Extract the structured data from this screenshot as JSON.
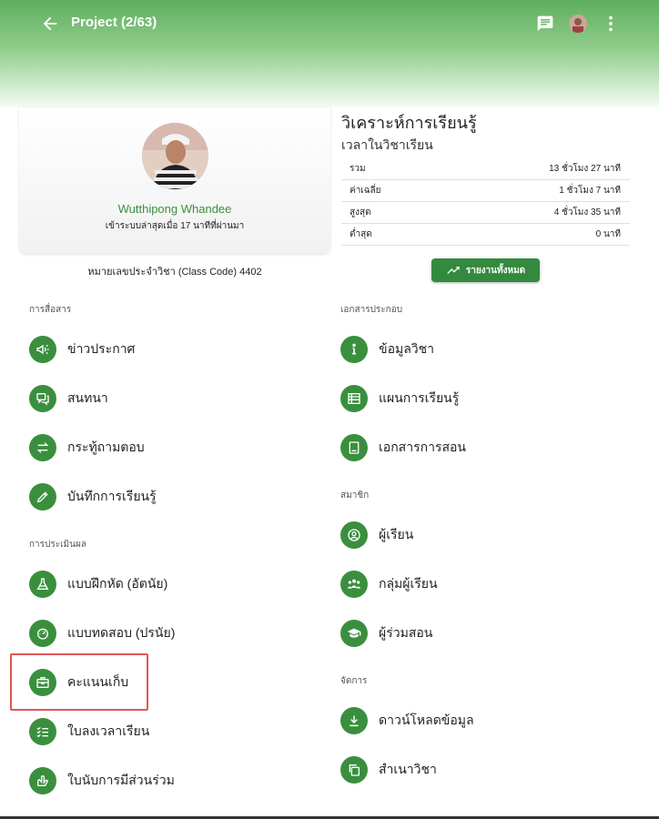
{
  "appbar": {
    "title": "Project (2/63)"
  },
  "profile": {
    "name": "Wutthipong Whandee",
    "last_login": "เข้าระบบล่าสุดเมื่อ 17 นาทีที่ผ่านมา",
    "class_code": "หมายเลขประจำวิชา (Class Code) 4402"
  },
  "analysis": {
    "title": "วิเคราะห์การเรียนรู้",
    "subtitle": "เวลาในวิชาเรียน",
    "rows": [
      {
        "label": "รวม",
        "value": "13 ชั่วโมง 27 นาที"
      },
      {
        "label": "ค่าเฉลี่ย",
        "value": "1 ชั่วโมง 7 นาที"
      },
      {
        "label": "สูงสุด",
        "value": "4 ชั่วโมง 35 นาที"
      },
      {
        "label": "ต่ำสุด",
        "value": "0 นาที"
      }
    ],
    "report_button": "รายงานทั้งหมด"
  },
  "left": {
    "communication": {
      "heading": "การสื่อสาร",
      "items": [
        {
          "label": "ข่าวประกาศ",
          "icon": "megaphone-icon"
        },
        {
          "label": "สนทนา",
          "icon": "forum-icon"
        },
        {
          "label": "กระทู้ถามตอบ",
          "icon": "swap-icon"
        },
        {
          "label": "บันทึกการเรียนรู้",
          "icon": "pencil-icon"
        }
      ]
    },
    "assessment": {
      "heading": "การประเมินผล",
      "items": [
        {
          "label": "แบบฝึกหัด (อัตนัย)",
          "icon": "flask-icon"
        },
        {
          "label": "แบบทดสอบ (ปรนัย)",
          "icon": "speedometer-icon"
        },
        {
          "label": "คะแนนเก็บ",
          "icon": "briefcase-icon"
        },
        {
          "label": "ใบลงเวลาเรียน",
          "icon": "checklist-icon"
        },
        {
          "label": "ใบนับการมีส่วนร่วม",
          "icon": "hand-icon"
        }
      ]
    }
  },
  "right": {
    "documents": {
      "heading": "เอกสารประกอบ",
      "items": [
        {
          "label": "ข้อมูลวิชา",
          "icon": "info-icon"
        },
        {
          "label": "แผนการเรียนรู้",
          "icon": "table-icon"
        },
        {
          "label": "เอกสารการสอน",
          "icon": "book-icon"
        }
      ]
    },
    "members": {
      "heading": "สมาชิก",
      "items": [
        {
          "label": "ผู้เรียน",
          "icon": "person-icon"
        },
        {
          "label": "กลุ่มผู้เรียน",
          "icon": "group-icon"
        },
        {
          "label": "ผู้ร่วมสอน",
          "icon": "graduation-cap-icon"
        }
      ]
    },
    "manage": {
      "heading": "จัดการ",
      "items": [
        {
          "label": "ดาวน์โหลดข้อมูล",
          "icon": "download-icon"
        },
        {
          "label": "สำเนาวิชา",
          "icon": "copy-icon"
        }
      ]
    }
  },
  "colors": {
    "accent": "#3a8f3e",
    "highlight": "#e05555"
  }
}
